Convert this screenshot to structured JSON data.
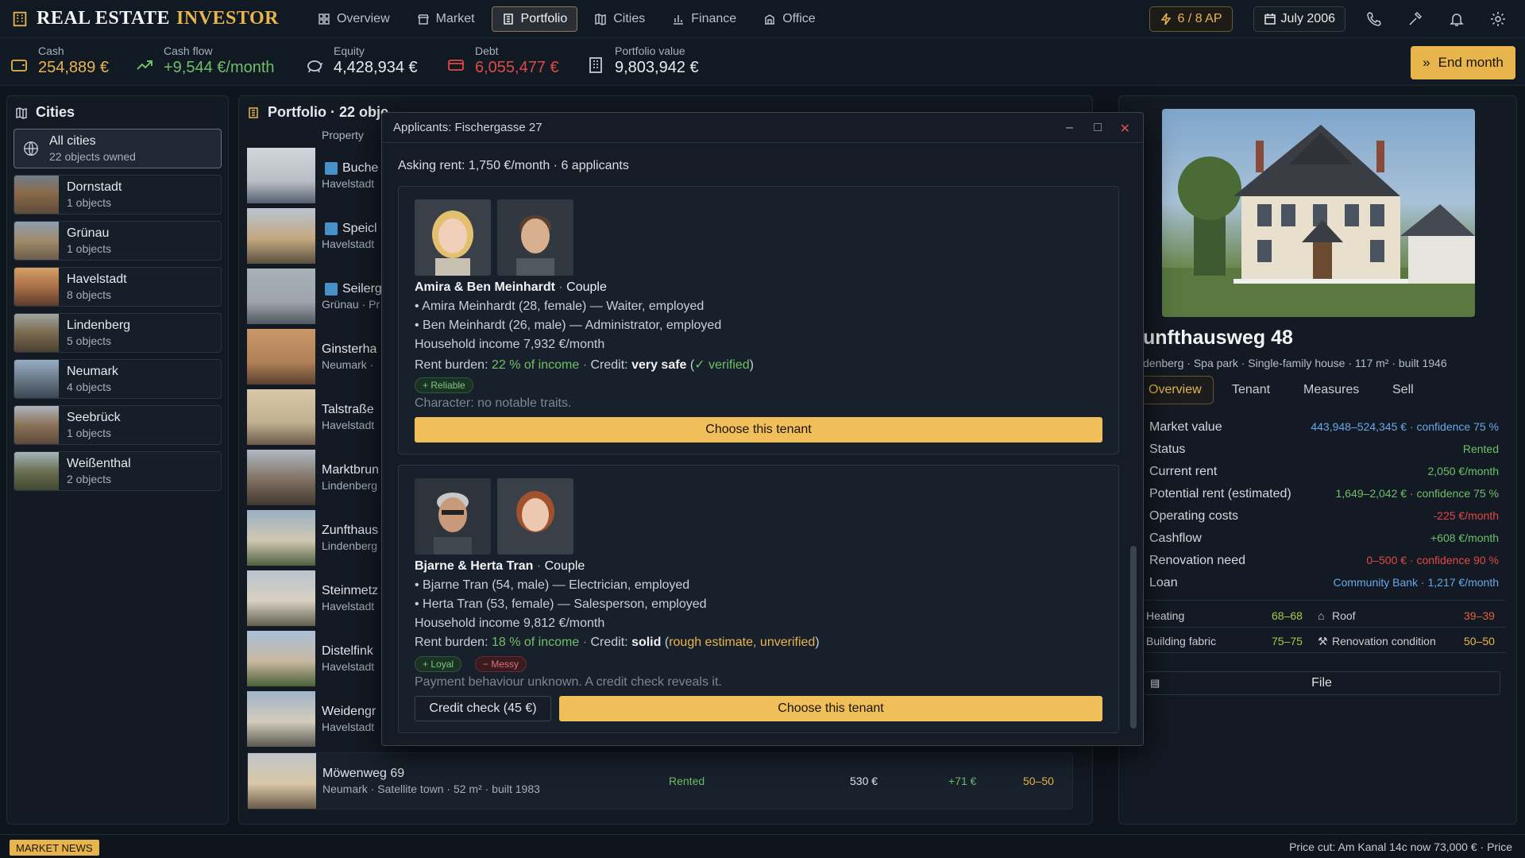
{
  "app": {
    "title_part1": "REAL ESTATE",
    "title_part2": "INVESTOR"
  },
  "nav": [
    {
      "label": "Overview",
      "icon": "dashboard-icon"
    },
    {
      "label": "Market",
      "icon": "market-icon"
    },
    {
      "label": "Portfolio",
      "icon": "portfolio-icon",
      "active": true
    },
    {
      "label": "Cities",
      "icon": "map-icon"
    },
    {
      "label": "Finance",
      "icon": "chart-icon"
    },
    {
      "label": "Office",
      "icon": "office-icon"
    }
  ],
  "top_right": {
    "ap": "6 / 8 AP",
    "date": "July 2006"
  },
  "stats": {
    "cash": {
      "label": "Cash",
      "value": "254,889 €"
    },
    "cashflow": {
      "label": "Cash flow",
      "value": "+9,544 €/month"
    },
    "equity": {
      "label": "Equity",
      "value": "4,428,934 €"
    },
    "debt": {
      "label": "Debt",
      "value": "6,055,477 €"
    },
    "portfolio_value": {
      "label": "Portfolio value",
      "value": "9,803,942 €"
    }
  },
  "end_month": "End month",
  "cities_panel": {
    "title": "Cities",
    "items": [
      {
        "name": "All cities",
        "sub": "22 objects owned"
      },
      {
        "name": "Dornstadt",
        "sub": "1 objects"
      },
      {
        "name": "Grünau",
        "sub": "1 objects"
      },
      {
        "name": "Havelstadt",
        "sub": "8 objects"
      },
      {
        "name": "Lindenberg",
        "sub": "5 objects"
      },
      {
        "name": "Neumark",
        "sub": "4 objects"
      },
      {
        "name": "Seebrück",
        "sub": "1 objects"
      },
      {
        "name": "Weißenthal",
        "sub": "2 objects"
      }
    ]
  },
  "portfolio": {
    "title": "Portfolio · 22 obje",
    "col_property": "Property",
    "rows": [
      {
        "name": "Buche",
        "sub": "Havelstadt"
      },
      {
        "name": "Speicl",
        "sub": "Havelstadt"
      },
      {
        "name": "Seilerg",
        "sub": "Grünau · Pr"
      },
      {
        "name": "Ginsterha",
        "sub": "Neumark ·"
      },
      {
        "name": "Talstraße",
        "sub": "Havelstadt"
      },
      {
        "name": "Marktbrun",
        "sub": "Lindenberg"
      },
      {
        "name": "Zunfthaus",
        "sub": "Lindenberg"
      },
      {
        "name": "Steinmetz",
        "sub": "Havelstadt"
      },
      {
        "name": "Distelfink",
        "sub": "Havelstadt"
      },
      {
        "name": "Weidengr",
        "sub": "Havelstadt"
      }
    ],
    "last_row": {
      "name": "Möwenweg 69",
      "sub": "Neumark · Satellite town · 52 m² · built 1983",
      "status": "Rented",
      "rent": "530 €",
      "cashflow": "+71 €",
      "cond": "50–50"
    }
  },
  "modal": {
    "title": "Applicants: Fischergasse 27",
    "asking": "Asking rent: 1,750 €/month · 6 applicants",
    "applicants": [
      {
        "names": "Amira & Ben Meinhardt",
        "type": "Couple",
        "p1": "• Amira Meinhardt (28, female) — Waiter, employed",
        "p2": "• Ben Meinhardt (26, male) — Administrator, employed",
        "income": "Household income 7,932 €/month",
        "burden_label": "Rent burden:",
        "burden": "22 % of income",
        "credit_label": "Credit:",
        "credit": "very safe",
        "credit_note": "✓ verified",
        "tags": [
          "+ Reliable"
        ],
        "note": "Character: no notable traits.",
        "choose": "Choose this tenant"
      },
      {
        "names": "Bjarne & Herta Tran",
        "type": "Couple",
        "p1": "• Bjarne Tran (54, male) — Electrician, employed",
        "p2": "• Herta Tran (53, female) — Salesperson, employed",
        "income": "Household income 9,812 €/month",
        "burden_label": "Rent burden:",
        "burden": "18 % of income",
        "credit_label": "Credit:",
        "credit": "solid",
        "credit_note": "rough estimate, unverified",
        "tags": [
          "+ Loyal",
          "− Messy"
        ],
        "note": "Payment behaviour unknown. A credit check reveals it.",
        "credit_check": "Credit check (45 €)",
        "choose": "Choose this tenant"
      }
    ]
  },
  "details": {
    "title": "unfthausweg 48",
    "sub": "denberg · Spa park · Single-family house · 117 m² · built 1946",
    "tabs": [
      "Overview",
      "Tenant",
      "Measures",
      "Sell"
    ],
    "kv": [
      {
        "k": "Market value",
        "v": "443,948–524,345 € · confidence 75 %",
        "color": "blue"
      },
      {
        "k": "Status",
        "v": "Rented",
        "color": "green"
      },
      {
        "k": "Current rent",
        "v": "2,050 €/month",
        "color": "green"
      },
      {
        "k": "Potential rent (estimated)",
        "v": "1,649–2,042 € · confidence 75 %",
        "color": "green"
      },
      {
        "k": "Operating costs",
        "v": "-225 €/month",
        "color": "red"
      },
      {
        "k": "Cashflow",
        "v": "+608 €/month",
        "color": "green"
      },
      {
        "k": "Renovation need",
        "v": "0–500 € · confidence 90 %",
        "color": "red"
      },
      {
        "k": "Loan",
        "v": "Community Bank · 1,217 €/month",
        "color": "blue"
      }
    ],
    "ratings": {
      "heating_label": "Heating",
      "heating": "68–68",
      "roof_label": "Roof",
      "roof": "39–39",
      "fabric_label": "Building fabric",
      "fabric": "75–75",
      "reno_label": "Renovation condition",
      "reno": "50–50"
    },
    "file": "File"
  },
  "footer": {
    "news": "MARKET NEWS",
    "ticker": "Price cut: Am Kanal 14c now 73,000 €  ·  Price"
  }
}
